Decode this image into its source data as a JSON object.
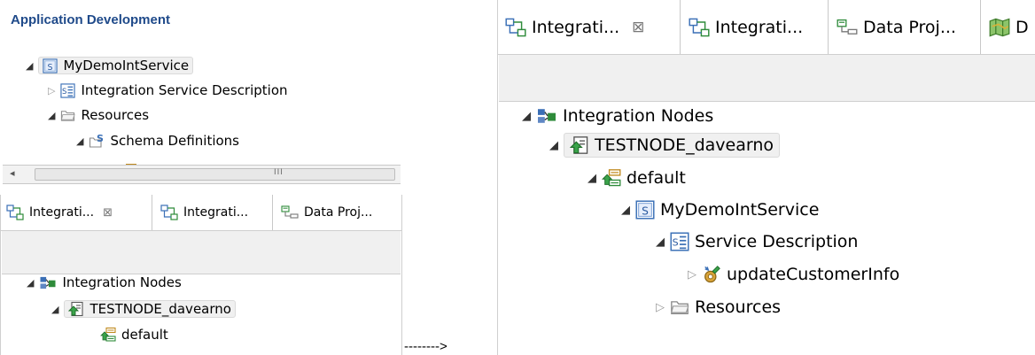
{
  "left_top": {
    "header": "Application Development",
    "tree": [
      {
        "label": "MyDemoIntService",
        "icon": "service-icon",
        "state": "open",
        "selected": true
      },
      {
        "label": "Integration Service Description",
        "icon": "service-description-icon",
        "state": "closed"
      },
      {
        "label": "Resources",
        "icon": "folder-icon",
        "state": "open"
      },
      {
        "label": "Schema Definitions",
        "icon": "schema-definitions-icon",
        "state": "open"
      }
    ],
    "scrollbar_grip": "III"
  },
  "left_bottom": {
    "tabs": [
      {
        "label": "Integrati...",
        "icon": "integration-explorer-icon",
        "active": true,
        "close": "⊠"
      },
      {
        "label": "Integrati...",
        "icon": "integration-explorer-icon"
      },
      {
        "label": "Data Proj...",
        "icon": "data-project-icon"
      }
    ],
    "tree": [
      {
        "label": "Integration Nodes",
        "icon": "integration-nodes-icon",
        "state": "open"
      },
      {
        "label": "TESTNODE_davearno",
        "icon": "node-icon",
        "state": "open",
        "selected": true
      },
      {
        "label": "default",
        "icon": "integration-server-icon",
        "state": "leaf"
      }
    ]
  },
  "arrow_text": "-------->",
  "right": {
    "tabs": [
      {
        "label": "Integrati...",
        "icon": "integration-explorer-icon",
        "active": true,
        "close": "⊠"
      },
      {
        "label": "Integrati...",
        "icon": "integration-explorer-icon"
      },
      {
        "label": "Data Proj...",
        "icon": "data-project-icon"
      },
      {
        "label": "D",
        "icon": "map-icon"
      }
    ],
    "tree": [
      {
        "label": "Integration Nodes",
        "icon": "integration-nodes-icon",
        "state": "open"
      },
      {
        "label": "TESTNODE_davearno",
        "icon": "node-icon",
        "state": "open",
        "selected": true
      },
      {
        "label": "default",
        "icon": "integration-server-icon",
        "state": "open"
      },
      {
        "label": "MyDemoIntService",
        "icon": "service-icon",
        "state": "open"
      },
      {
        "label": "Service Description",
        "icon": "service-description-icon",
        "state": "open"
      },
      {
        "label": "updateCustomerInfo",
        "icon": "operation-icon",
        "state": "closed"
      },
      {
        "label": "Resources",
        "icon": "folder-icon",
        "state": "closed"
      }
    ]
  },
  "colors": {
    "header_blue": "#1f4a8a",
    "icon_green": "#2e8b3a",
    "icon_blue": "#3a6fb6",
    "selection_bg": "#f0f0f0"
  }
}
